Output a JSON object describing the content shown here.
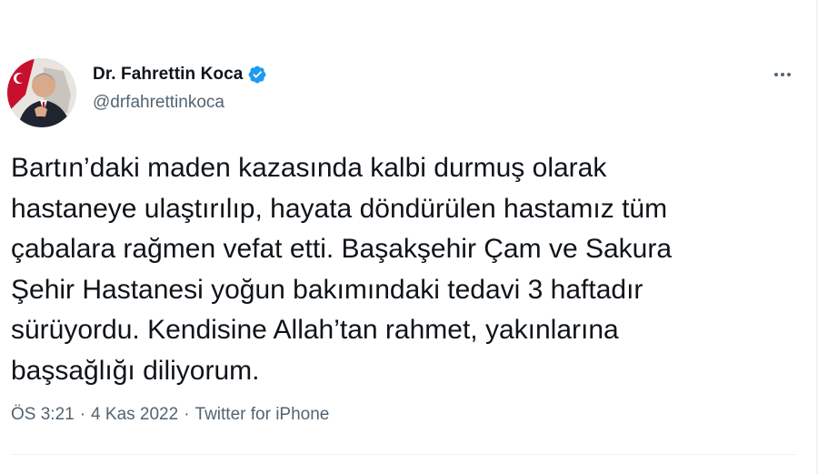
{
  "author": {
    "display_name": "Dr. Fahrettin Koca",
    "handle": "@drfahrettinkoca",
    "verified": true,
    "verified_icon": "verified-badge-icon",
    "verified_color": "#1d9bf0"
  },
  "more_icon": "more-options-icon",
  "tweet": {
    "text": "Bartın’daki maden kazasında kalbi durmuş olarak\nhastaneye ulaştırılıp, hayata döndürülen hastamız tüm\nçabalara rağmen vefat etti. Başakşehir Çam ve Sakura\nŞehir Hastanesi yoğun bakımındaki tedavi 3 haftadır\nsürüyordu. Kendisine Allah’tan rahmet, yakınlarına\nbaşsağlığı diliyorum."
  },
  "meta": {
    "time": "ÖS 3:21",
    "date": "4 Kas 2022",
    "source": "Twitter for iPhone",
    "separator": "·"
  },
  "colors": {
    "text_primary": "#0f1419",
    "text_secondary": "#536471",
    "divider": "#eff3f4"
  }
}
